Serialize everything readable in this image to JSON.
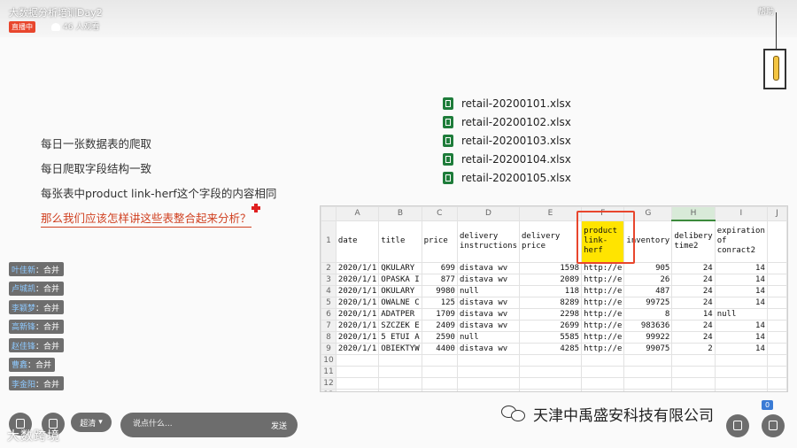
{
  "header": {
    "title": "大数据分析培训Day2",
    "live_badge": "直播中",
    "viewers": "46 人观看",
    "help": "帮助"
  },
  "files": [
    "retail-20200101.xlsx",
    "retail-20200102.xlsx",
    "retail-20200103.xlsx",
    "retail-20200104.xlsx",
    "retail-20200105.xlsx"
  ],
  "bullets": [
    "每日一张数据表的爬取",
    "每日爬取字段结构一致",
    "每张表中product link-herf这个字段的内容相同"
  ],
  "question": "那么我们应该怎样讲这些表整合起来分析？",
  "spreadsheet": {
    "columns": [
      "A",
      "B",
      "C",
      "D",
      "E",
      "F",
      "G",
      "H",
      "I",
      "J"
    ],
    "headers": [
      "date",
      "title",
      "price",
      "delivery instructions",
      "delivery price",
      "product link-herf",
      "inventory",
      "delibery time2",
      "expiration of conract2"
    ],
    "rows": [
      [
        "2020/1/1",
        "QKULARY",
        "699",
        "distava wv",
        "1598",
        "http://e",
        "905",
        "24",
        "14"
      ],
      [
        "2020/1/1",
        "OPASKA I",
        "877",
        "distava wv",
        "2089",
        "http://e",
        "26",
        "24",
        "14"
      ],
      [
        "2020/1/1",
        "OKULARY",
        "9980",
        "null",
        "118",
        "http://e",
        "487",
        "24",
        "14"
      ],
      [
        "2020/1/1",
        "OWALNE C",
        "125",
        "distava wv",
        "8289",
        "http://e",
        "99725",
        "24",
        "14"
      ],
      [
        "2020/1/1",
        "ADATPER",
        "1709",
        "distava wv",
        "2298",
        "http://e",
        "8",
        "14",
        "null"
      ],
      [
        "2020/1/1",
        "SZCZEK E",
        "2409",
        "distava wv",
        "2699",
        "http://e",
        "983636",
        "24",
        "14"
      ],
      [
        "2020/1/1",
        "5 ETUI A",
        "2590",
        "null",
        "5585",
        "http://e",
        "99922",
        "24",
        "14"
      ],
      [
        "2020/1/1",
        "OBIEKTYW",
        "4400",
        "distava wv",
        "4285",
        "http://e",
        "99075",
        "2",
        "14"
      ]
    ],
    "empty_rows": [
      "10",
      "11",
      "12",
      "13"
    ]
  },
  "chat": [
    {
      "user": "叶佳新",
      "msg": "合并"
    },
    {
      "user": "卢城凯",
      "msg": "合并"
    },
    {
      "user": "李颖梦",
      "msg": "合并"
    },
    {
      "user": "高新锋",
      "msg": "合并"
    },
    {
      "user": "赵佳锋",
      "msg": "合并"
    },
    {
      "user": "曹鑫",
      "msg": "合并"
    },
    {
      "user": "李金阳",
      "msg": "合并"
    }
  ],
  "bottom": {
    "quality": "超清",
    "input_placeholder": "说点什么...",
    "send": "发送",
    "watermark": "大数跨境",
    "company": "天津中禹盛安科技有限公司",
    "count": "0"
  }
}
